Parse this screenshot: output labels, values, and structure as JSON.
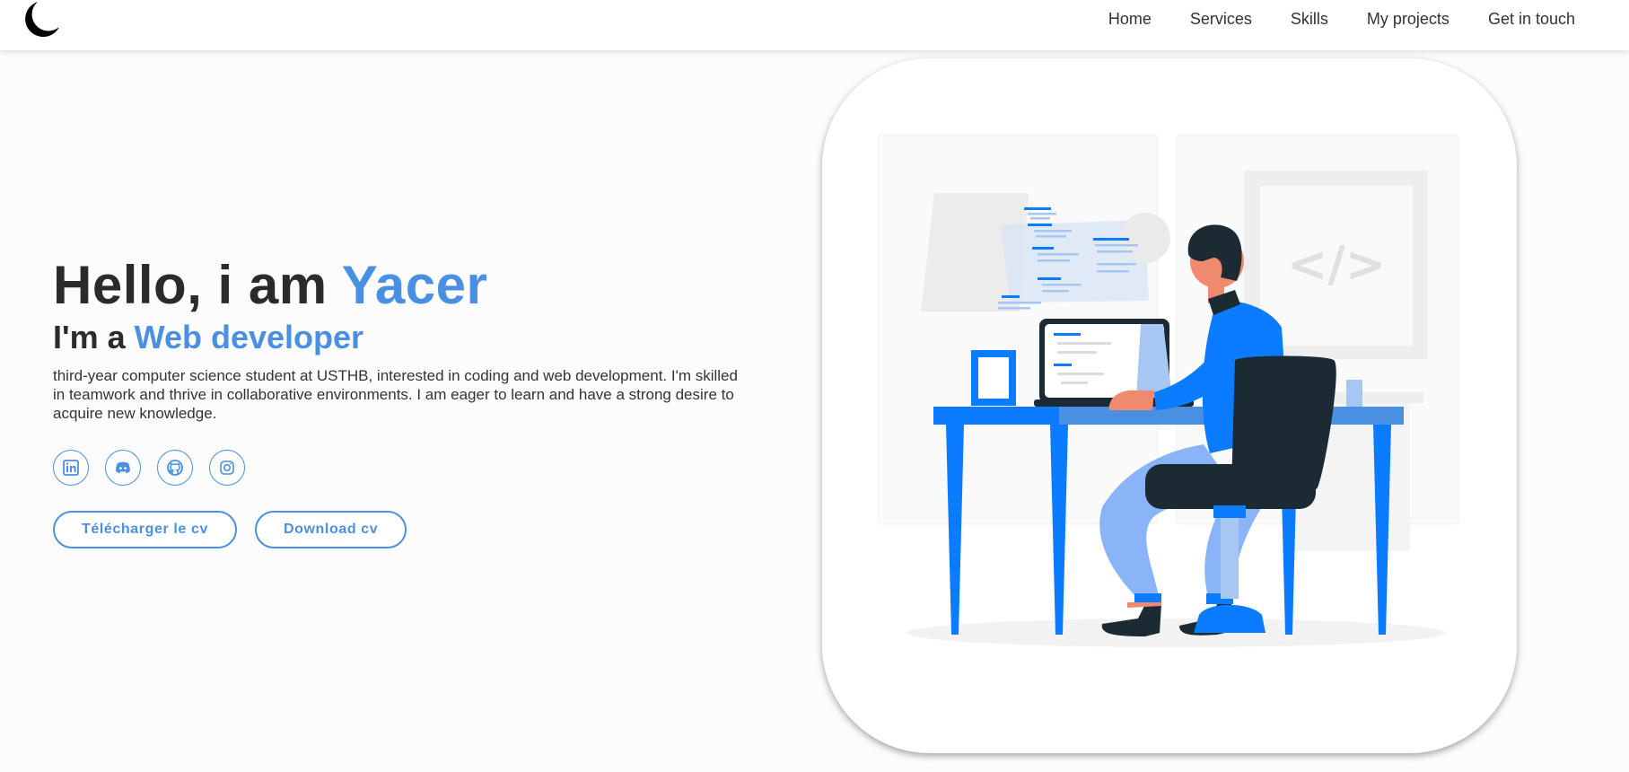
{
  "nav": {
    "logo_icon": "crescent-moon-icon",
    "items": [
      "Home",
      "Services",
      "Skills",
      "My projects",
      "Get in touch"
    ]
  },
  "hero": {
    "greeting": "Hello, i am ",
    "name": "Yacer",
    "role_prefix": "I'm a ",
    "role": "Web developer",
    "bio": "third-year computer science student at USTHB, interested in coding and web development. I'm skilled in teamwork and thrive in collaborative environments. I am eager to learn and have a strong desire to acquire new knowledge.",
    "socials": [
      "linkedin-icon",
      "discord-icon",
      "github-icon",
      "instagram-icon"
    ],
    "buttons": {
      "cv_fr": "Télécharger le cv",
      "cv_en": "Download cv"
    }
  },
  "illustration": {
    "code_symbol": "</>"
  },
  "colors": {
    "accent": "#4a90e2",
    "illustration_blue": "#0b7bff",
    "dark": "#1c2b33"
  }
}
